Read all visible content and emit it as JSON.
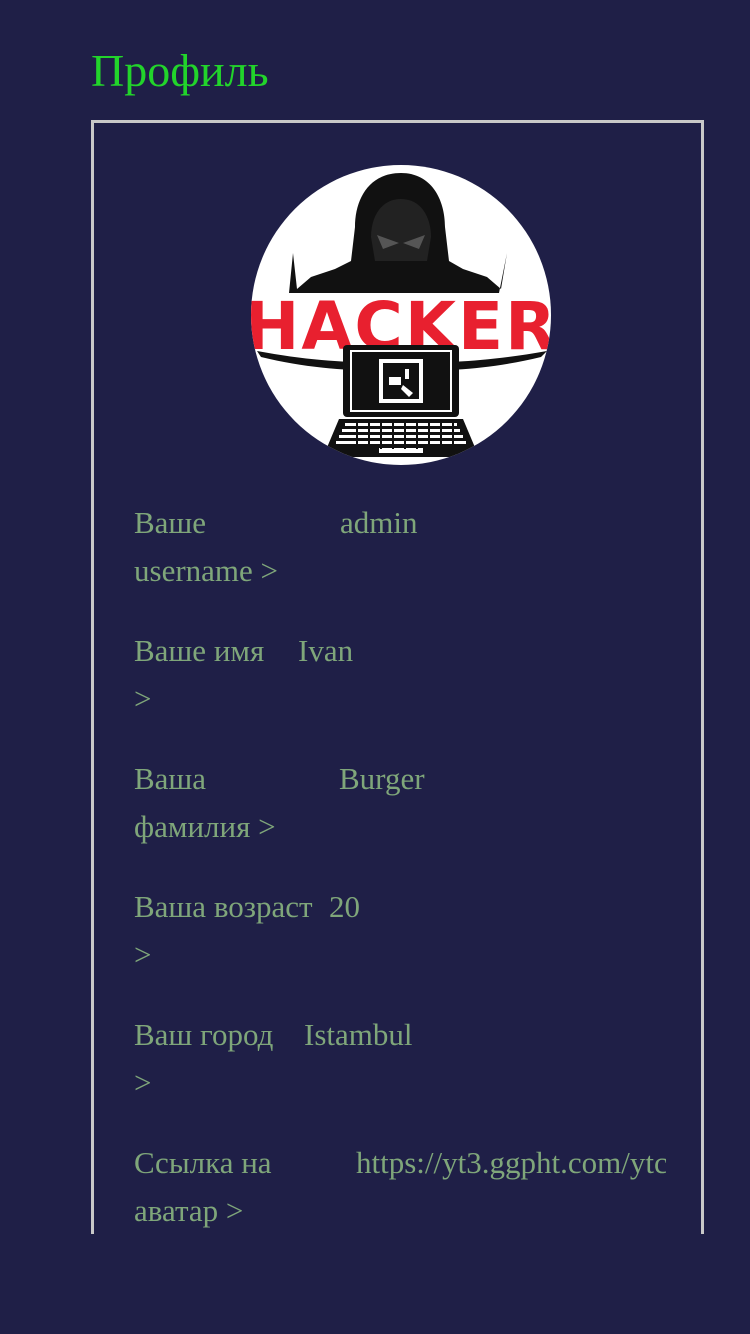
{
  "page": {
    "title": "Профиль",
    "colors": {
      "background": "#1f1f47",
      "title": "#22d42b",
      "field_text": "#7fa67a",
      "panel_border": "#c8c8c8"
    }
  },
  "avatar": {
    "logo_text": "HACKER",
    "icon": "hacker-avatar-icon"
  },
  "fields": [
    {
      "label_line1": "Ваше",
      "label_line2": "username >",
      "value": "admin"
    },
    {
      "label_line1": "Ваше имя",
      "label_line2": ">",
      "value": "Ivan"
    },
    {
      "label_line1": "Ваша",
      "label_line2": "фамилия >",
      "value": "Burger"
    },
    {
      "label_line1": "Ваша возраст",
      "label_line2": ">",
      "value": "20"
    },
    {
      "label_line1": "Ваш город",
      "label_line2": ">",
      "value": "Istambul"
    },
    {
      "label_line1": "Ссылка на",
      "label_line2": "аватар >",
      "value": "https://yt3.ggpht.com/ytc"
    }
  ]
}
